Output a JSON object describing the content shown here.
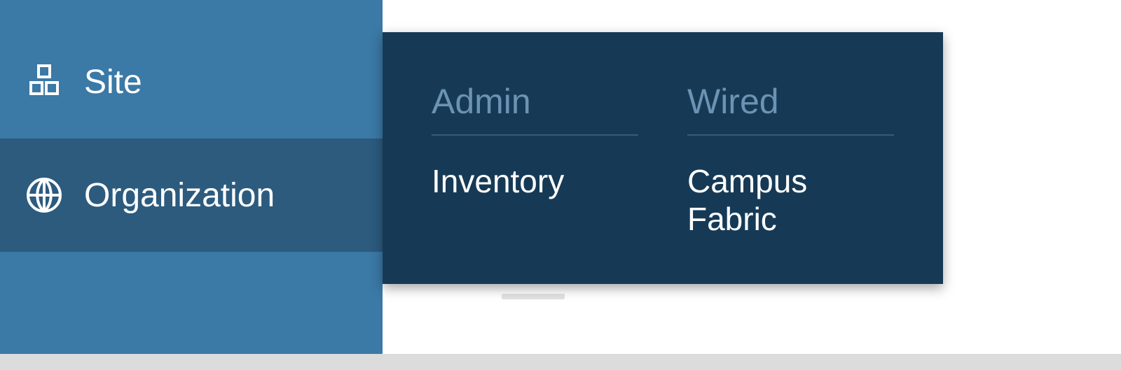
{
  "sidebar": {
    "items": [
      {
        "label": "Site"
      },
      {
        "label": "Organization"
      }
    ]
  },
  "flyout": {
    "columns": [
      {
        "heading": "Admin",
        "links": [
          "Inventory"
        ]
      },
      {
        "heading": "Wired",
        "links": [
          "Campus Fabric"
        ]
      }
    ]
  },
  "colors": {
    "sidebar_bg": "#3b79a6",
    "sidebar_active_bg": "#2c5b7e",
    "flyout_bg": "#163a56",
    "flyout_heading": "#6b93b3"
  }
}
